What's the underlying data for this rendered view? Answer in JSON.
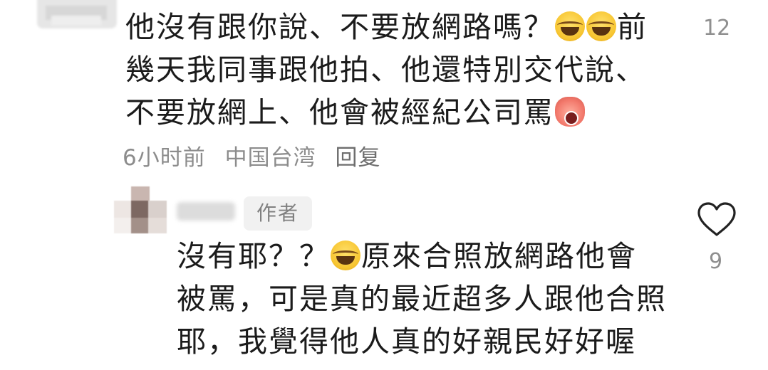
{
  "comment1": {
    "lines": [
      "他沒有跟你說、不要放網路嗎？",
      "前",
      "幾天我同事跟他拍、他還特別交代說、",
      "不要放網上、他會被經紀公司罵"
    ],
    "time": "6小时前",
    "location": "中国台湾",
    "reply_label": "回复",
    "like_count": "12"
  },
  "comment2": {
    "badge": "作者",
    "lines": [
      "沒有耶？？",
      "原來合照放網路他會",
      "被罵，可是真的最近超多人跟他合照",
      "耶，我覺得他人真的好親民好好喔"
    ],
    "like_count": "9"
  },
  "icons": {
    "laugh_emoji": "face-with-tears-of-joy",
    "cry_emoji": "loudly-crying-face",
    "like": "heart-outline"
  },
  "colors": {
    "text": "#1b1b1b",
    "meta": "#8c8c8c",
    "badge_bg": "#f1f1f1"
  }
}
